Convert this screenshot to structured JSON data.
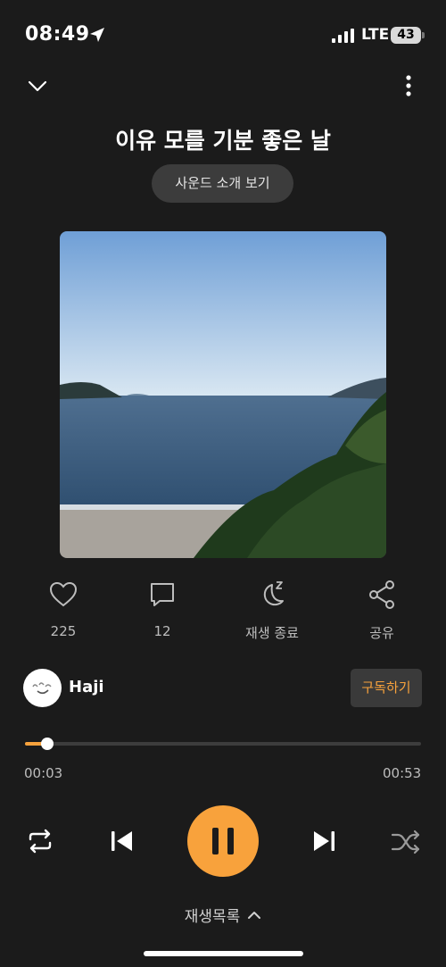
{
  "status_bar": {
    "time": "08:49",
    "network": "LTE",
    "battery": "43"
  },
  "header": {
    "title": "이유 모를 기분 좋은 날",
    "intro_button": "사운드 소개 보기"
  },
  "actions": {
    "like_count": "225",
    "comment_count": "12",
    "sleep_label": "재생 종료",
    "share_label": "공유"
  },
  "artist": {
    "name": "Haji",
    "subscribe_label": "구독하기"
  },
  "player": {
    "current_time": "00:03",
    "total_time": "00:53",
    "progress": 0.057,
    "playlist_label": "재생목록"
  },
  "colors": {
    "accent": "#f8a23c",
    "background": "#1b1b1b"
  },
  "icons": [
    "location-arrow-icon",
    "signal-icon",
    "chevron-down-icon",
    "more-vertical-icon",
    "heart-icon",
    "comment-icon",
    "moon-zzz-icon",
    "share-icon",
    "repeat-icon",
    "skip-previous-icon",
    "pause-icon",
    "skip-next-icon",
    "shuffle-icon",
    "chevron-up-icon"
  ]
}
